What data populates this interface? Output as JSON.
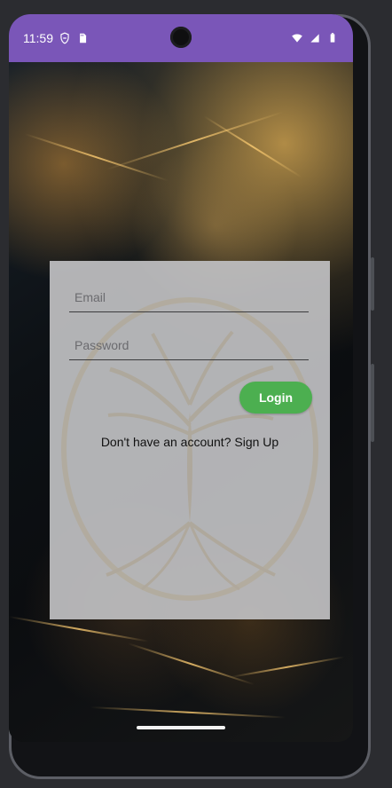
{
  "status_bar": {
    "time": "11:59",
    "left_icons": [
      "shield-icon",
      "sd-card-icon"
    ],
    "right_icons": [
      "wifi-icon",
      "signal-icon",
      "battery-icon"
    ]
  },
  "login": {
    "email_placeholder": "Email",
    "password_placeholder": "Password",
    "button_label": "Login",
    "signup_text": "Don't have an account? Sign Up"
  },
  "colors": {
    "status_bar": "#7a56b8",
    "card": "#bfbfc2",
    "button": "#4caf50"
  }
}
